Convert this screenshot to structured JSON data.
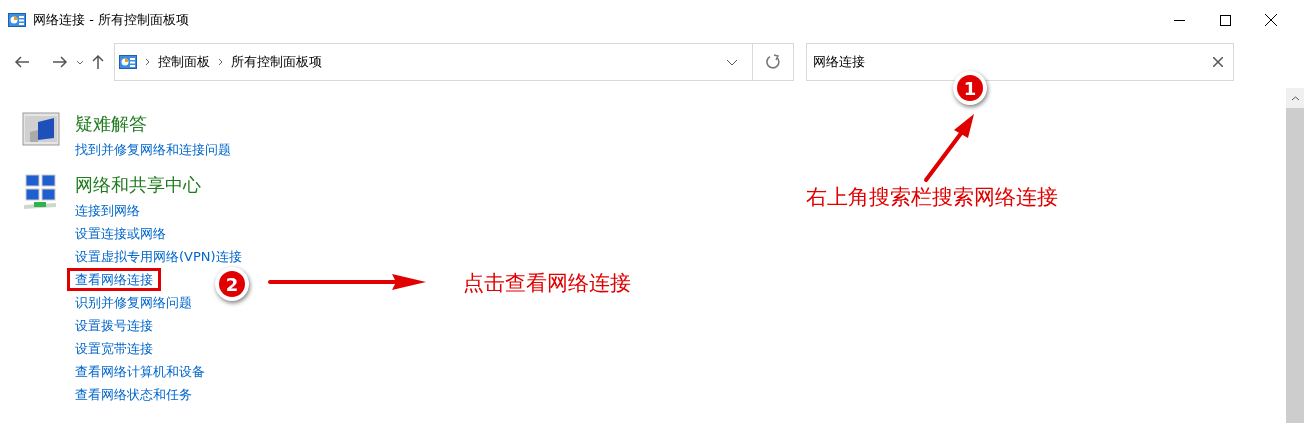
{
  "window": {
    "title": "网络连接 - 所有控制面板项"
  },
  "address_bar": {
    "breadcrumbs": [
      "控制面板",
      "所有控制面板项"
    ]
  },
  "search": {
    "value": "网络连接"
  },
  "sections": [
    {
      "kind": "troubleshooting",
      "title": "疑难解答",
      "links": [
        {
          "text": "找到并修复网络和连接问题",
          "highlighted": false
        }
      ]
    },
    {
      "kind": "network",
      "title": "网络和共享中心",
      "links": [
        {
          "text": "连接到网络",
          "highlighted": false
        },
        {
          "text": "设置连接或网络",
          "highlighted": false
        },
        {
          "text": "设置虚拟专用网络(VPN)连接",
          "highlighted": false
        },
        {
          "text": "查看网络连接",
          "highlighted": true
        },
        {
          "text": "识别并修复网络问题",
          "highlighted": false
        },
        {
          "text": "设置拨号连接",
          "highlighted": false
        },
        {
          "text": "设置宽带连接",
          "highlighted": false
        },
        {
          "text": "查看网络计算机和设备",
          "highlighted": false
        },
        {
          "text": "查看网络状态和任务",
          "highlighted": false
        }
      ]
    }
  ],
  "annotations": [
    {
      "kind": "search",
      "number": "1",
      "text": "右上角搜索栏搜索网络连接"
    },
    {
      "kind": "link",
      "number": "2",
      "text": "点击查看网络连接"
    }
  ]
}
